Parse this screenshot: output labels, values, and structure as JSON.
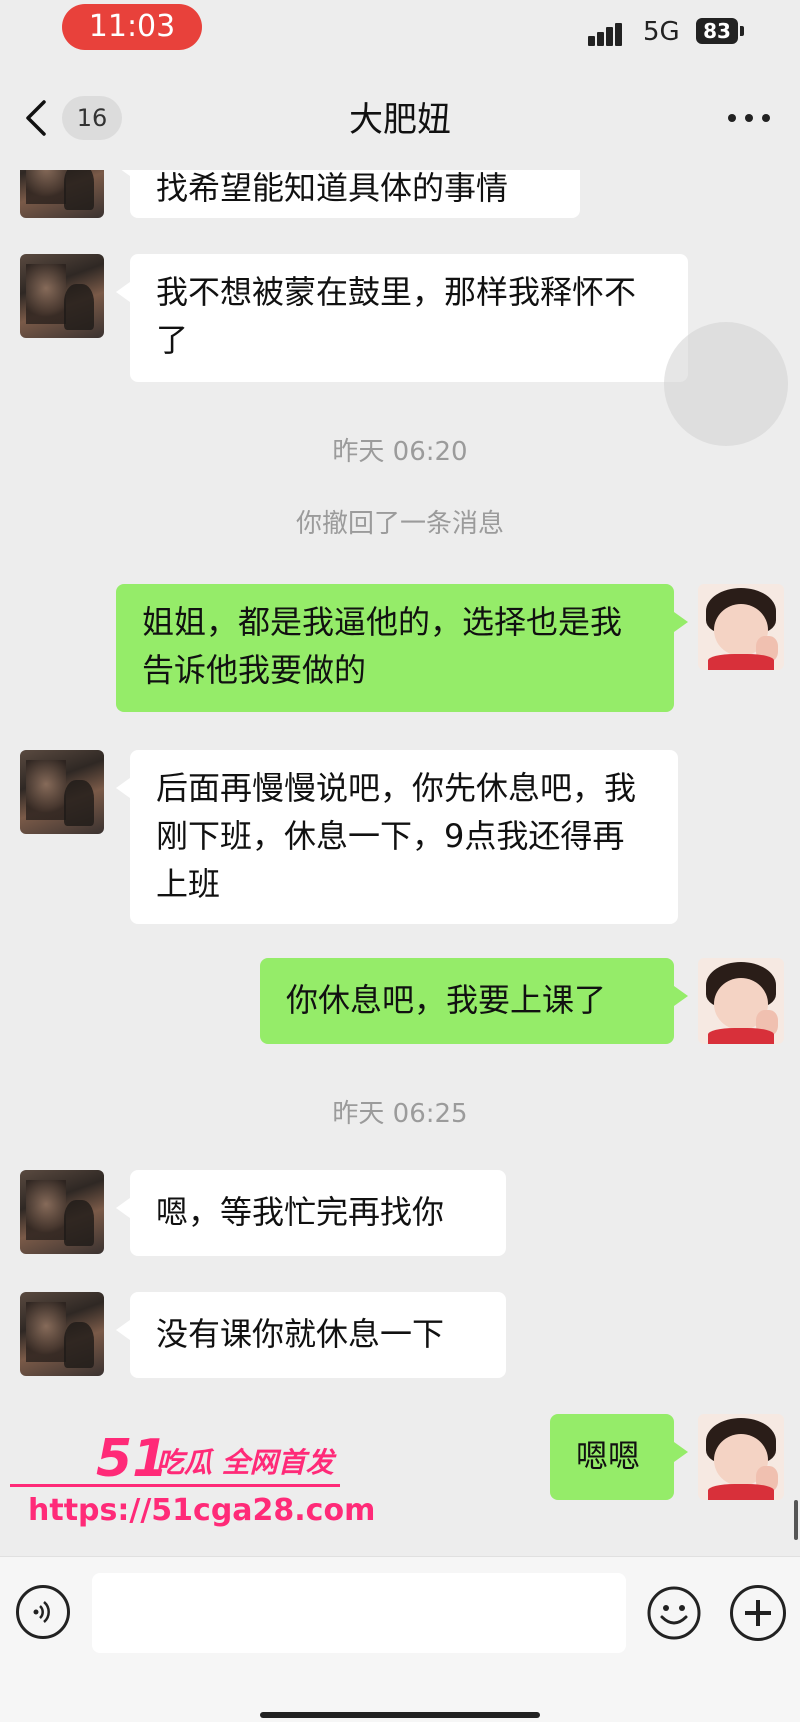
{
  "status_bar": {
    "time": "11:03",
    "network": "5G",
    "battery": "83"
  },
  "header": {
    "unread_count": "16",
    "title": "大肥妞"
  },
  "messages": [
    {
      "text": "找希望能知道具体的事情"
    },
    {
      "text": "我不想被蒙在鼓里，那样我释怀不了"
    },
    {
      "text": "昨天 06:20"
    },
    {
      "text": "你撤回了一条消息"
    },
    {
      "text": "姐姐，都是我逼他的，选择也是我告诉他我要做的"
    },
    {
      "text": "后面再慢慢说吧，你先休息吧，我刚下班，休息一下，9点我还得再上班"
    },
    {
      "text": "你休息吧，我要上课了"
    },
    {
      "text": "昨天 06:25"
    },
    {
      "text": "嗯，等我忙完再找你"
    },
    {
      "text": "没有课你就休息一下"
    },
    {
      "text": "嗯嗯"
    }
  ],
  "watermark": {
    "logo": "51",
    "tagline": "吃瓜 全网首发",
    "url": "https://51cga28.com"
  },
  "icons": [
    "back-icon",
    "more-icon",
    "voice-icon",
    "emoji-icon",
    "plus-icon"
  ]
}
